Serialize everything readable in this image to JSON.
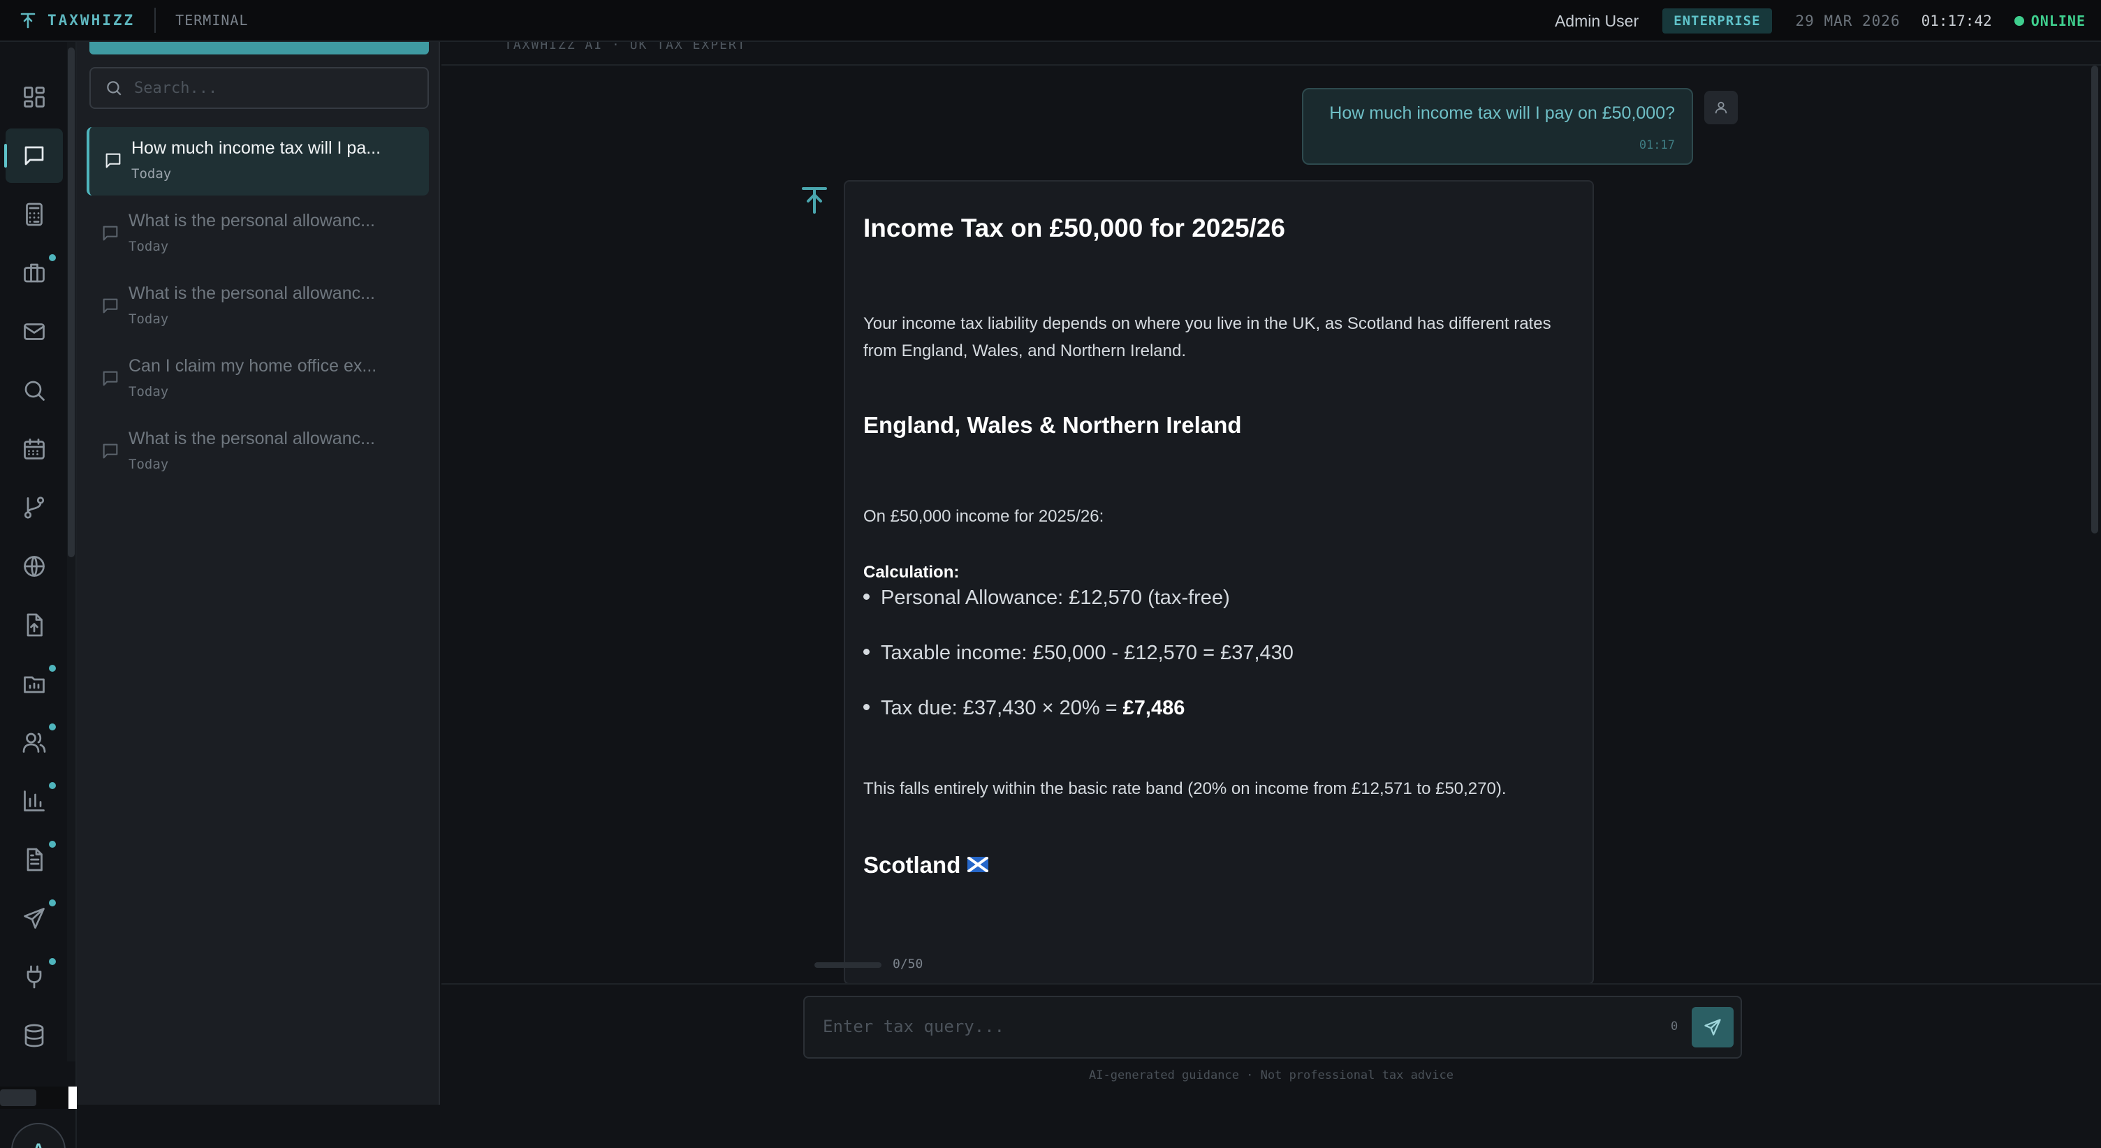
{
  "header": {
    "brand": "TAXWHIZZ",
    "section": "TERMINAL",
    "user": "Admin User",
    "plan": "ENTERPRISE",
    "date": "29 MAR 2026",
    "time": "01:17:42",
    "status": "ONLINE",
    "status_color": "#3fcf8e",
    "accent_color": "#5fc2c9"
  },
  "rail": {
    "items": [
      {
        "icon": "dashboard-icon",
        "active": false,
        "badge": false
      },
      {
        "icon": "chat-icon",
        "active": true,
        "badge": false
      },
      {
        "icon": "calculator-icon",
        "active": false,
        "badge": false
      },
      {
        "icon": "briefcase-icon",
        "active": false,
        "badge": true
      },
      {
        "icon": "mail-icon",
        "active": false,
        "badge": false
      },
      {
        "icon": "search-icon",
        "active": false,
        "badge": false
      },
      {
        "icon": "calendar-icon",
        "active": false,
        "badge": false
      },
      {
        "icon": "git-branch-icon",
        "active": false,
        "badge": false
      },
      {
        "icon": "globe-icon",
        "active": false,
        "badge": false
      },
      {
        "icon": "file-upload-icon",
        "active": false,
        "badge": false
      },
      {
        "icon": "folder-chart-icon",
        "active": false,
        "badge": true
      },
      {
        "icon": "users-icon",
        "active": false,
        "badge": true
      },
      {
        "icon": "bar-chart-icon",
        "active": false,
        "badge": true
      },
      {
        "icon": "document-icon",
        "active": false,
        "badge": true
      },
      {
        "icon": "send-icon",
        "active": false,
        "badge": true
      },
      {
        "icon": "plug-icon",
        "active": false,
        "badge": true
      },
      {
        "icon": "database-icon",
        "active": false,
        "badge": false
      }
    ],
    "avatar_initial": "A"
  },
  "sidebar": {
    "search_placeholder": "Search...",
    "conversations": [
      {
        "title": "How much income tax will I pa...",
        "date": "Today",
        "active": true
      },
      {
        "title": "What is the personal allowanc...",
        "date": "Today",
        "active": false
      },
      {
        "title": "What is the personal allowanc...",
        "date": "Today",
        "active": false
      },
      {
        "title": "Can I claim my home office ex...",
        "date": "Today",
        "active": false
      },
      {
        "title": "What is the personal allowanc...",
        "date": "Today",
        "active": false
      }
    ]
  },
  "chat": {
    "header_label": "TAXWHIZZ AI · UK TAX EXPERT",
    "user_message": {
      "text": "How much income tax will I pay on £50,000?",
      "time": "01:17"
    },
    "answer": {
      "title": "Income Tax on £50,000 for 2025/26",
      "intro": "Your income tax liability depends on where you live in the UK, as Scotland has different rates from England, Wales, and Northern Ireland.",
      "section1_title": "England, Wales & Northern Ireland",
      "section1_lead": "On £50,000 income for 2025/26:",
      "calc_label": "Calculation:",
      "bullets": [
        "Personal Allowance: £12,570 (tax-free)",
        "Taxable income: £50,000 - £12,570 = £37,430",
        "Tax due: £37,430 × 20% = "
      ],
      "tax_due_value": "£7,486",
      "section1_note": "This falls entirely within the basic rate band (20% on income from £12,571 to £50,270).",
      "section2_title": "Scotland"
    },
    "counter": "0/50",
    "composer_placeholder": "Enter tax query...",
    "char_count": "0",
    "disclaimer": "AI-generated guidance · Not professional tax advice"
  }
}
